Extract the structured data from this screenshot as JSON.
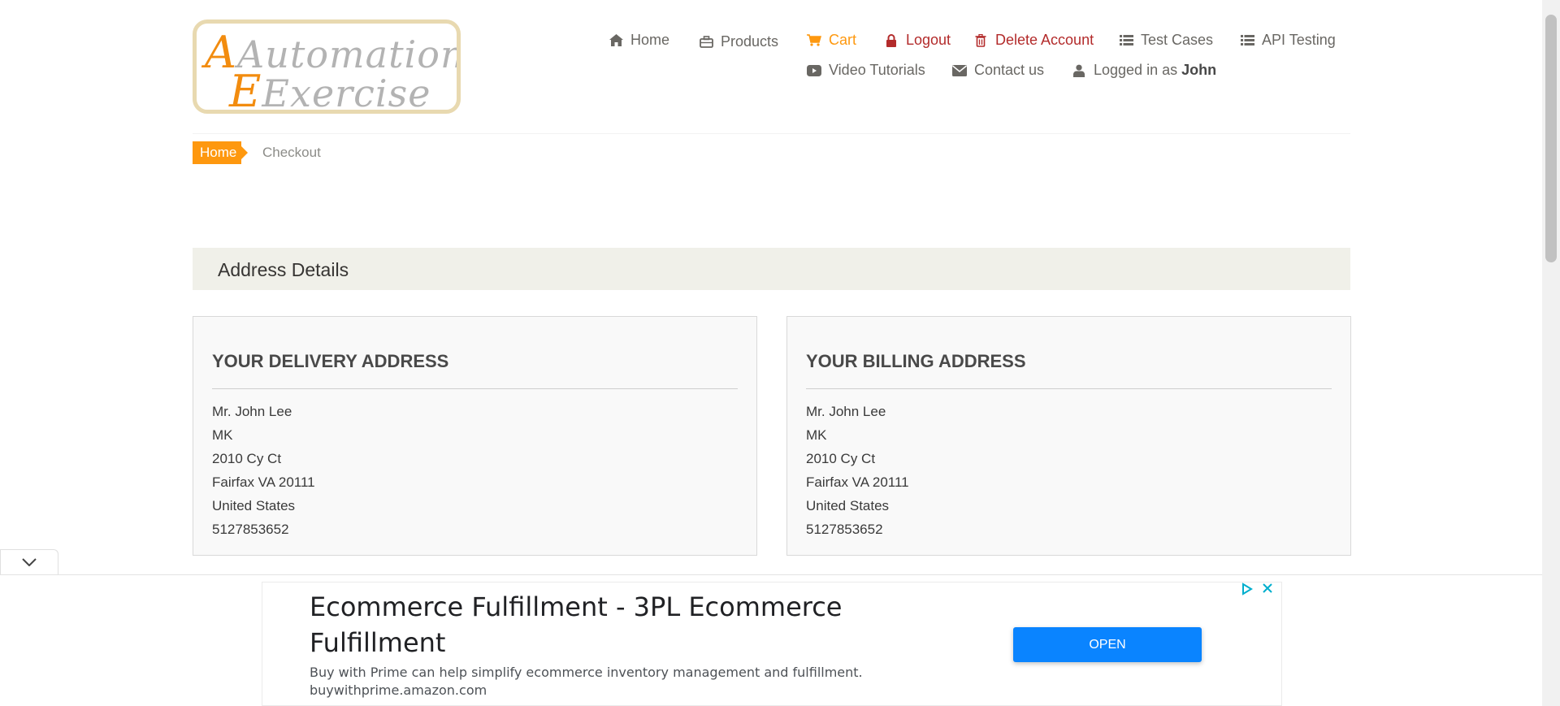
{
  "logo": {
    "line1": "Automation",
    "line2": "Exercise"
  },
  "nav": {
    "home": "Home",
    "products": "Products",
    "cart": "Cart",
    "logout": "Logout",
    "delete_account": "Delete Account",
    "test_cases": "Test Cases",
    "api_testing": "API Testing",
    "video_tutorials": "Video Tutorials",
    "contact_us": "Contact us",
    "logged_in_prefix": "Logged in as",
    "logged_in_user": "John"
  },
  "breadcrumb": {
    "home": "Home",
    "current": "Checkout"
  },
  "section": {
    "title": "Address Details"
  },
  "delivery": {
    "heading": "YOUR DELIVERY ADDRESS",
    "lines": [
      "Mr. John Lee",
      "MK",
      "2010 Cy Ct",
      "Fairfax VA 20111",
      "United States",
      "5127853652"
    ]
  },
  "billing": {
    "heading": "YOUR BILLING ADDRESS",
    "lines": [
      "Mr. John Lee",
      "MK",
      "2010 Cy Ct",
      "Fairfax VA 20111",
      "United States",
      "5127853652"
    ]
  },
  "ad": {
    "title": "Ecommerce Fulfillment - 3PL Ecommerce Fulfillment",
    "description": "Buy with Prime can help simplify ecommerce inventory management and fulfillment.",
    "url": "buywithprime.amazon.com",
    "button": "OPEN"
  },
  "colors": {
    "accent": "#fe980f",
    "danger": "#b32b2b",
    "ad_button": "#0a84ff"
  }
}
